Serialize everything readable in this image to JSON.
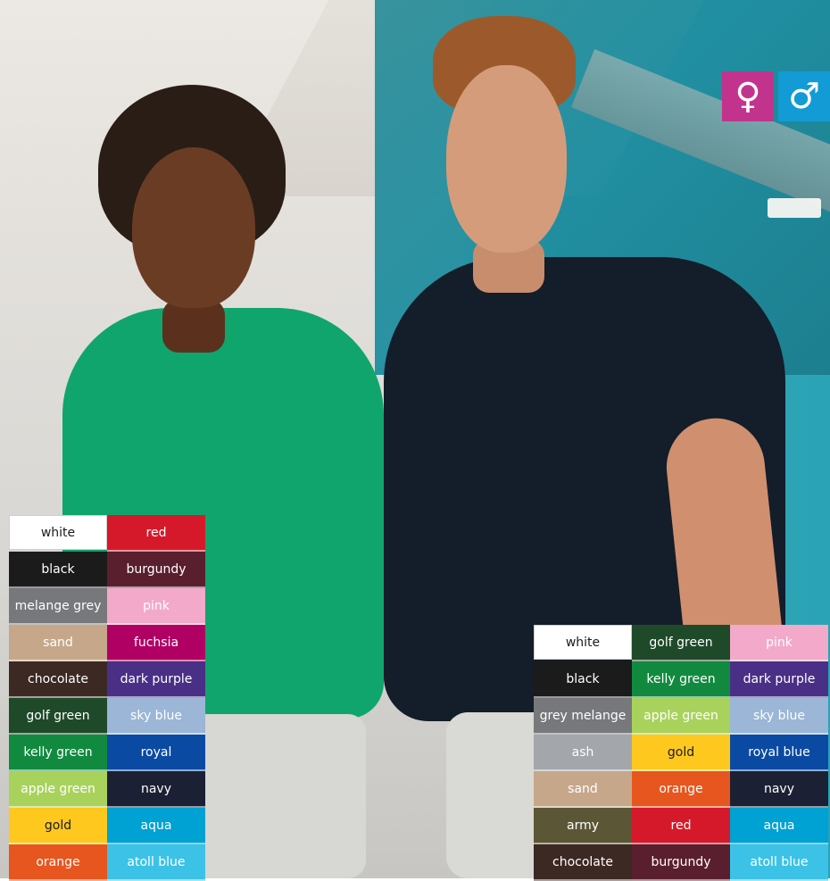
{
  "gender_icons": {
    "female": {
      "symbol": "♀",
      "color": "#c2338e"
    },
    "male": {
      "symbol": "♂",
      "color": "#139bd6"
    }
  },
  "left_swatches": [
    {
      "label": "white",
      "color": "#ffffff",
      "text": "#1b1b1b"
    },
    {
      "label": "red",
      "color": "#d6192a",
      "text": "#ffffff"
    },
    {
      "label": "black",
      "color": "#1b1b1b",
      "text": "#ffffff"
    },
    {
      "label": "burgundy",
      "color": "#5a1f2f",
      "text": "#ffffff"
    },
    {
      "label": "melange grey",
      "color": "#77787b",
      "text": "#ffffff"
    },
    {
      "label": "pink",
      "color": "#f3a9c9",
      "text": "#ffffff"
    },
    {
      "label": "sand",
      "color": "#c6a78a",
      "text": "#ffffff"
    },
    {
      "label": "fuchsia",
      "color": "#b10064",
      "text": "#ffffff"
    },
    {
      "label": "chocolate",
      "color": "#3c2923",
      "text": "#ffffff"
    },
    {
      "label": "dark purple",
      "color": "#4a2f86",
      "text": "#ffffff"
    },
    {
      "label": "golf green",
      "color": "#1f4a2a",
      "text": "#ffffff"
    },
    {
      "label": "sky blue",
      "color": "#9bb6d6",
      "text": "#ffffff"
    },
    {
      "label": "kelly green",
      "color": "#118a3f",
      "text": "#ffffff"
    },
    {
      "label": "royal",
      "color": "#0b4aa2",
      "text": "#ffffff"
    },
    {
      "label": "apple green",
      "color": "#a9d25d",
      "text": "#ffffff"
    },
    {
      "label": "navy",
      "color": "#1c2034",
      "text": "#ffffff"
    },
    {
      "label": "gold",
      "color": "#ffc81e",
      "text": "#1b1b1b"
    },
    {
      "label": "aqua",
      "color": "#00a1d3",
      "text": "#ffffff"
    },
    {
      "label": "orange",
      "color": "#e7561f",
      "text": "#ffffff"
    },
    {
      "label": "atoll blue",
      "color": "#3cc2e6",
      "text": "#ffffff"
    }
  ],
  "right_swatches": [
    {
      "label": "white",
      "color": "#ffffff",
      "text": "#1b1b1b"
    },
    {
      "label": "golf green",
      "color": "#1f4a2a",
      "text": "#ffffff"
    },
    {
      "label": "pink",
      "color": "#f3a9c9",
      "text": "#ffffff"
    },
    {
      "label": "black",
      "color": "#1b1b1b",
      "text": "#ffffff"
    },
    {
      "label": "kelly green",
      "color": "#118a3f",
      "text": "#ffffff"
    },
    {
      "label": "dark purple",
      "color": "#4a2f86",
      "text": "#ffffff"
    },
    {
      "label": "grey melange",
      "color": "#77787b",
      "text": "#ffffff"
    },
    {
      "label": "apple green",
      "color": "#a9d25d",
      "text": "#ffffff"
    },
    {
      "label": "sky blue",
      "color": "#9bb6d6",
      "text": "#ffffff"
    },
    {
      "label": "ash",
      "color": "#a3a6aa",
      "text": "#ffffff"
    },
    {
      "label": "gold",
      "color": "#ffc81e",
      "text": "#1b1b1b"
    },
    {
      "label": "royal blue",
      "color": "#0b4aa2",
      "text": "#ffffff"
    },
    {
      "label": "sand",
      "color": "#c6a78a",
      "text": "#ffffff"
    },
    {
      "label": "orange",
      "color": "#e7561f",
      "text": "#ffffff"
    },
    {
      "label": "navy",
      "color": "#1c2034",
      "text": "#ffffff"
    },
    {
      "label": "army",
      "color": "#5b5736",
      "text": "#ffffff"
    },
    {
      "label": "red",
      "color": "#d6192a",
      "text": "#ffffff"
    },
    {
      "label": "aqua",
      "color": "#00a1d3",
      "text": "#ffffff"
    },
    {
      "label": "chocolate",
      "color": "#3c2923",
      "text": "#ffffff"
    },
    {
      "label": "burgundy",
      "color": "#5a1f2f",
      "text": "#ffffff"
    },
    {
      "label": "atoll blue",
      "color": "#3cc2e6",
      "text": "#ffffff"
    }
  ]
}
